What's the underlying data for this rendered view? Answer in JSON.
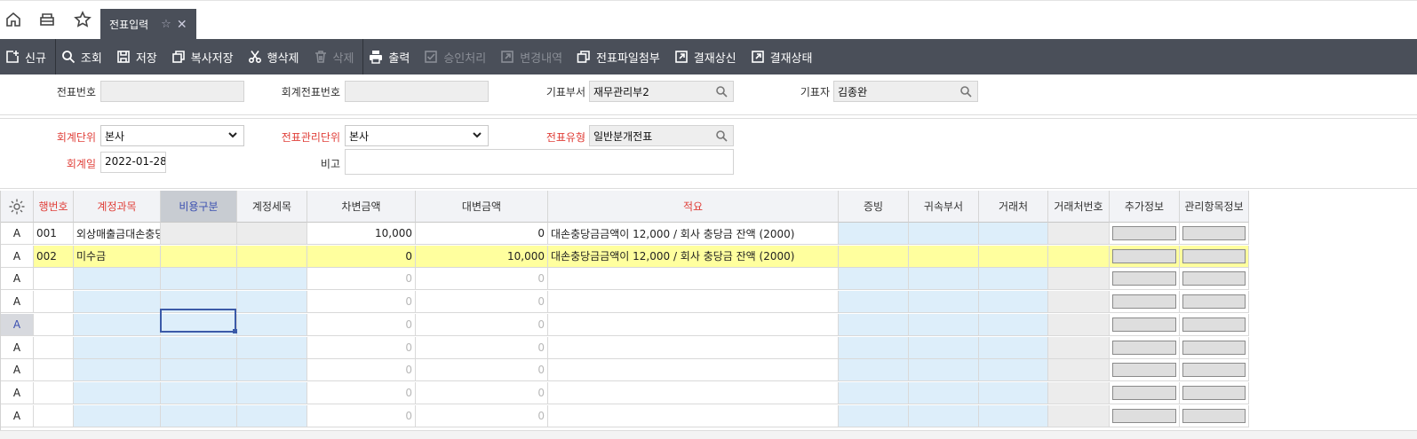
{
  "tabs": {
    "active_label": "전표입력"
  },
  "toolbar": {
    "buttons": [
      {
        "label": "신규",
        "icon": "new-doc-icon",
        "enabled": true
      },
      {
        "label": "조회",
        "icon": "search-icon",
        "enabled": true
      },
      {
        "label": "저장",
        "icon": "save-icon",
        "enabled": true
      },
      {
        "label": "복사저장",
        "icon": "copy-save-icon",
        "enabled": true
      },
      {
        "label": "행삭제",
        "icon": "scissors-icon",
        "enabled": true
      },
      {
        "label": "삭제",
        "icon": "trash-icon",
        "enabled": false
      },
      {
        "label": "출력",
        "icon": "print-icon",
        "enabled": true
      },
      {
        "label": "승인처리",
        "icon": "check-box-icon",
        "enabled": false
      },
      {
        "label": "변경내역",
        "icon": "open-external-icon",
        "enabled": false
      },
      {
        "label": "전표파일첨부",
        "icon": "copy-icon",
        "enabled": true
      },
      {
        "label": "결재상신",
        "icon": "open-external-icon",
        "enabled": true
      },
      {
        "label": "결재상태",
        "icon": "open-external-icon",
        "enabled": true
      }
    ]
  },
  "form1": {
    "slip_no_label": "전표번호",
    "slip_no_value": "",
    "acct_slip_no_label": "회계전표번호",
    "acct_slip_no_value": "",
    "dept_label": "기표부서",
    "dept_value": "재무관리부2",
    "writer_label": "기표자",
    "writer_value": "김종완"
  },
  "form2": {
    "unit_label": "회계단위",
    "unit_value": "본사",
    "mgmt_unit_label": "전표관리단위",
    "mgmt_unit_value": "본사",
    "type_label": "전표유형",
    "type_value": "일반분개전표",
    "date_label": "회계일",
    "date_value": "2022-01-28",
    "note_label": "비고",
    "note_value": ""
  },
  "grid": {
    "headers": [
      "행번호",
      "계정과목",
      "비용구분",
      "계정세목",
      "차변금액",
      "대변금액",
      "적요",
      "증빙",
      "귀속부서",
      "거래처",
      "거래처번호",
      "추가정보",
      "관리항목정보"
    ],
    "rows": [
      {
        "state": "A",
        "no": "001",
        "account": "외상매출금대손충당",
        "debit": "10,000",
        "credit": "0",
        "memo": "대손충당금금액이 12,000 / 회사 충당금 잔액 (2000)"
      },
      {
        "state": "A",
        "no": "002",
        "account": "미수금",
        "debit": "0",
        "credit": "10,000",
        "memo": "대손충당금금액이 12,000 / 회사 충당금 잔액 (2000)"
      },
      {
        "state": "A",
        "no": "",
        "account": "",
        "debit": "0",
        "credit": "0",
        "memo": ""
      },
      {
        "state": "A",
        "no": "",
        "account": "",
        "debit": "0",
        "credit": "0",
        "memo": ""
      },
      {
        "state": "A",
        "no": "",
        "account": "",
        "debit": "0",
        "credit": "0",
        "memo": ""
      },
      {
        "state": "A",
        "no": "",
        "account": "",
        "debit": "0",
        "credit": "0",
        "memo": ""
      },
      {
        "state": "A",
        "no": "",
        "account": "",
        "debit": "0",
        "credit": "0",
        "memo": ""
      },
      {
        "state": "A",
        "no": "",
        "account": "",
        "debit": "0",
        "credit": "0",
        "memo": ""
      },
      {
        "state": "A",
        "no": "",
        "account": "",
        "debit": "0",
        "credit": "0",
        "memo": ""
      }
    ]
  },
  "colors": {
    "toolbar_bg": "#4a4f59",
    "required_label": "#e0403a",
    "editable_cell": "#ddeefa",
    "selected_row": "#ffff9e"
  }
}
